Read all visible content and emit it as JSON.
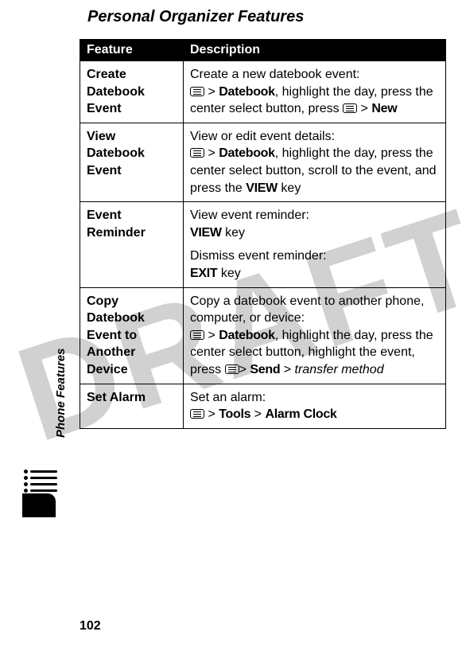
{
  "page": {
    "title": "Personal Organizer Features",
    "side_label": "Phone Features",
    "page_number": "102",
    "watermark": "DRAFT"
  },
  "table": {
    "head": {
      "feature": "Feature",
      "description": "Description"
    },
    "rows": [
      {
        "feature": "Create Datebook Event",
        "desc": {
          "lead": "Create a new datebook event:",
          "step1_pre": "",
          "menu1": true,
          "gt1": " > ",
          "datebook": "Datebook",
          "mid1": ", highlight the day, press the center select button, press ",
          "menu2": true,
          "gt2": " > ",
          "new": "New"
        }
      },
      {
        "feature": "View Datebook Event",
        "desc": {
          "lead": "View or edit event details:",
          "menu1": true,
          "gt1": " > ",
          "datebook": "Datebook",
          "mid1": ", highlight the day, press the center select button, scroll to the event, and press the ",
          "view": "VIEW",
          "tail": " key"
        }
      },
      {
        "feature": "Event Reminder",
        "desc": {
          "lead1": "View event reminder:",
          "view": "VIEW",
          "key1": " key",
          "lead2": "Dismiss event reminder:",
          "exit": "EXIT",
          "key2": " key"
        }
      },
      {
        "feature": "Copy Datebook Event to Another Device",
        "desc": {
          "lead": "Copy a datebook event to another phone, computer, or device:",
          "menu1": true,
          "gt1": " > ",
          "datebook": "Datebook",
          "mid1": ", highlight the day, press the center select button, highlight the event, press ",
          "menu2": true,
          "gt2": "> ",
          "send": "Send",
          "gt3": " > ",
          "transfer": "transfer method"
        }
      },
      {
        "feature": "Set Alarm",
        "desc": {
          "lead": "Set an alarm:",
          "menu1": true,
          "gt1": " > ",
          "tools": "Tools",
          "gt2": " > ",
          "alarm": "Alarm Clock"
        }
      }
    ]
  }
}
